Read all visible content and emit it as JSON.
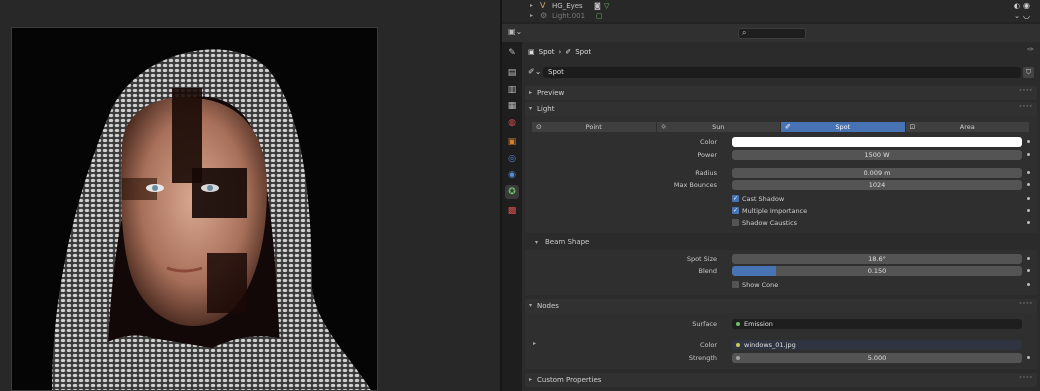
{
  "outliner": {
    "rows": [
      {
        "label": "HG_Eyes",
        "color": "#d0a070"
      },
      {
        "label": "Light.001",
        "color": "#7a7a7a"
      }
    ]
  },
  "properties": {
    "breadcrumb": [
      "Spot",
      "Spot"
    ],
    "data_name": "Spot",
    "panels": {
      "preview": "Preview",
      "light": "Light",
      "nodes": "Nodes",
      "custom": "Custom Properties"
    },
    "light_types": [
      {
        "label": "Point",
        "icon": "point-light-icon",
        "active": false
      },
      {
        "label": "Sun",
        "icon": "sun-light-icon",
        "active": false
      },
      {
        "label": "Spot",
        "icon": "spot-light-icon",
        "active": true
      },
      {
        "label": "Area",
        "icon": "area-light-icon",
        "active": false
      }
    ],
    "light": {
      "color_label": "Color",
      "color_value": "#ffffff",
      "power_label": "Power",
      "power_value": "1500 W",
      "radius_label": "Radius",
      "radius_value": "0.009 m",
      "bounces_label": "Max Bounces",
      "bounces_value": "1024",
      "cast_shadow": {
        "label": "Cast Shadow",
        "checked": true
      },
      "multiple_importance": {
        "label": "Multiple Importance",
        "checked": true
      },
      "shadow_caustics": {
        "label": "Shadow Caustics",
        "checked": false
      }
    },
    "beam_shape": {
      "title": "Beam Shape",
      "spot_size_label": "Spot Size",
      "spot_size_value": "18.6°",
      "blend_label": "Blend",
      "blend_value": "0.150",
      "blend_fraction": 0.15,
      "show_cone": {
        "label": "Show Cone",
        "checked": false
      }
    },
    "nodes": {
      "surface_label": "Surface",
      "surface_value": "Emission",
      "color_label": "Color",
      "color_value": "windows_01.jpg",
      "strength_label": "Strength",
      "strength_value": "5.000"
    }
  },
  "colors": {
    "accent": "#4772b3",
    "surface_dot": "#6ec06e",
    "image_dot": "#c8c850",
    "strength_dot": "#a0a0a0"
  }
}
